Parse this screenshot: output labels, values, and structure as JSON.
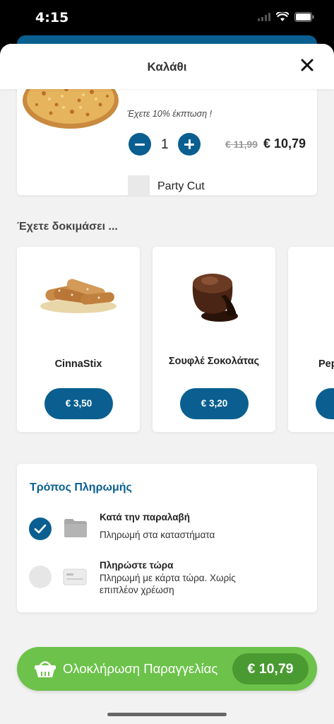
{
  "status_bar": {
    "time": "4:15"
  },
  "header": {
    "title": "Καλάθι"
  },
  "cart": {
    "item": {
      "discount_note": "Έχετε 10% έκπτωση !",
      "quantity": "1",
      "old_price": "€ 11,99",
      "new_price": "€ 10,79",
      "option_label": "Party Cut"
    }
  },
  "suggestions": {
    "title": "Έχετε δοκιμάσει ...",
    "items": [
      {
        "name": "CinnaStix",
        "price": "€ 3,50"
      },
      {
        "name": "Σουφλέ Σοκολάτας",
        "price": "€ 3,20"
      },
      {
        "name": "Pep",
        "price": ""
      }
    ]
  },
  "payment": {
    "title": "Τρόπος Πληρωμής",
    "options": [
      {
        "label": "Κατά την παραλαβή",
        "description": "Πληρωμή στα καταστήματα",
        "selected": true
      },
      {
        "label": "Πληρώστε τώρα",
        "description": "Πληρωμή με κάρτα τώρα. Χωρίς επιπλέον χρέωση",
        "selected": false
      }
    ]
  },
  "checkout": {
    "label": "Ολοκλήρωση Παραγγελίας",
    "total": "€ 10,79"
  },
  "colors": {
    "primary": "#0a5f90",
    "checkout_green": "#6cc24a",
    "checkout_green_dark": "#4a9a32"
  }
}
